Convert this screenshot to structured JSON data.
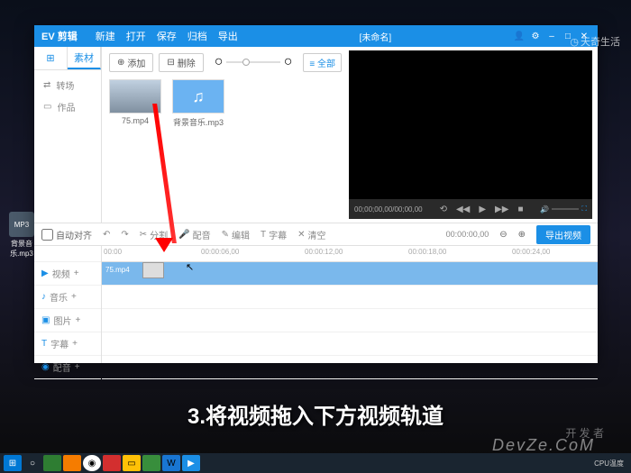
{
  "app": {
    "title": "EV 剪辑",
    "menu": [
      "新建",
      "打开",
      "保存",
      "归档",
      "导出"
    ],
    "document": "[未命名]"
  },
  "sidebar": {
    "tabs": {
      "icon": "grid",
      "material": "素材"
    },
    "items": [
      {
        "icon": "transition",
        "label": "转场"
      },
      {
        "icon": "folder",
        "label": "作品"
      }
    ]
  },
  "media_toolbar": {
    "add": "添加",
    "delete": "删除",
    "filter": "全部"
  },
  "media_items": [
    {
      "type": "video",
      "name": "75.mp4"
    },
    {
      "type": "audio",
      "name": "背景音乐.mp3"
    }
  ],
  "preview": {
    "time": "00;00;00,00/00;00,00",
    "controls": [
      "loop",
      "prev",
      "play",
      "next",
      "stop"
    ]
  },
  "timeline_toolbar": {
    "auto_align": "自动对齐",
    "tools": [
      {
        "icon": "undo",
        "label": ""
      },
      {
        "icon": "cut",
        "label": "分割"
      },
      {
        "icon": "mic",
        "label": "配音"
      },
      {
        "icon": "edit",
        "label": "编辑"
      },
      {
        "icon": "text",
        "label": "字幕"
      },
      {
        "icon": "clear",
        "label": "清空"
      }
    ],
    "time": "00:00:00,00",
    "export": "导出视频"
  },
  "ruler_marks": [
    "00:00",
    "00:00:06,00",
    "00:00:12,00",
    "00:00:18,00",
    "00:00:24,00"
  ],
  "tracks": [
    {
      "icon": "▶",
      "label": "视频",
      "kind": "video"
    },
    {
      "icon": "♪",
      "label": "音乐",
      "kind": "audio"
    },
    {
      "icon": "▣",
      "label": "图片",
      "kind": "image"
    },
    {
      "icon": "T",
      "label": "字幕",
      "kind": "subtitle"
    },
    {
      "icon": "🎤",
      "label": "配音",
      "kind": "voice"
    }
  ],
  "clip": {
    "name": "75.mp4"
  },
  "watermark": "天奇生活",
  "desktop_icon": {
    "label": "背景音乐.mp3",
    "badge": "MP3"
  },
  "caption": "3.将视频拖入下方视频轨道",
  "subcaption": "DevZe.CoM",
  "subcaption2": "开 发 者",
  "taskbar": {
    "time": "CPU温度"
  }
}
